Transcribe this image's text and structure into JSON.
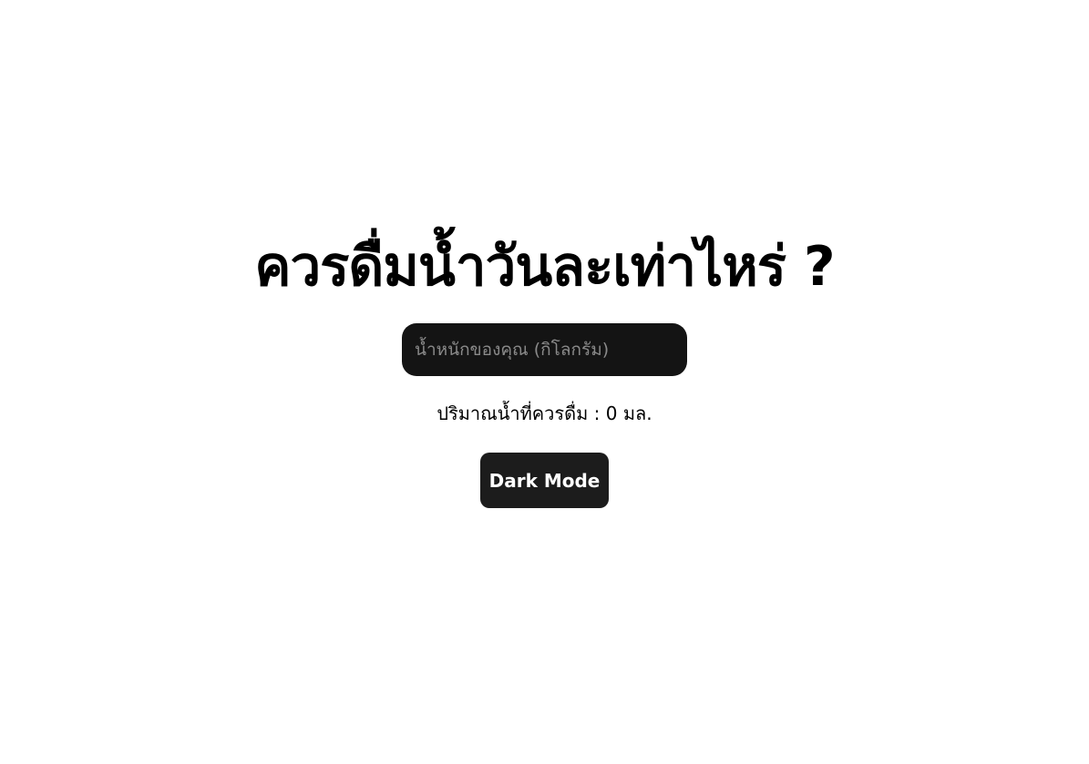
{
  "page": {
    "title": "ควรดื่มน้ำวันละเท่าไหร่ ?",
    "background_color": "#ffffff"
  },
  "weight_input": {
    "placeholder": "น้ำหนักของคุณ (กิโลกรัม)",
    "value": ""
  },
  "result": {
    "label": "ปริมาณน้ำที่ควรดื่ม : 0 มล."
  },
  "dark_mode_button": {
    "label": "Dark Mode"
  },
  "colors": {
    "input_background": "#141414",
    "button_background": "#1c1c1c",
    "text": "#000000"
  }
}
